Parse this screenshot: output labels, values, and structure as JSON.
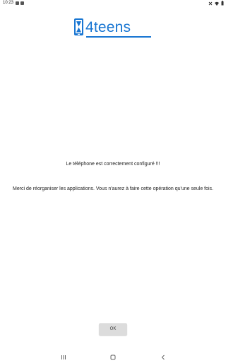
{
  "status_bar": {
    "time": "10:23"
  },
  "logo": {
    "text": "4teens",
    "icon": "hourglass-phone-icon",
    "color": "#1976d2"
  },
  "messages": {
    "configured": "Le téléphone est correctement configuré !!!",
    "reorganize": "Merci de réorganiser les applications. Vous n'aurez à faire cette opération qu'une seule fois."
  },
  "actions": {
    "ok_label": "OK"
  },
  "nav": {
    "recent_icon": "recent-apps-icon",
    "home_icon": "home-icon",
    "back_icon": "back-icon"
  }
}
